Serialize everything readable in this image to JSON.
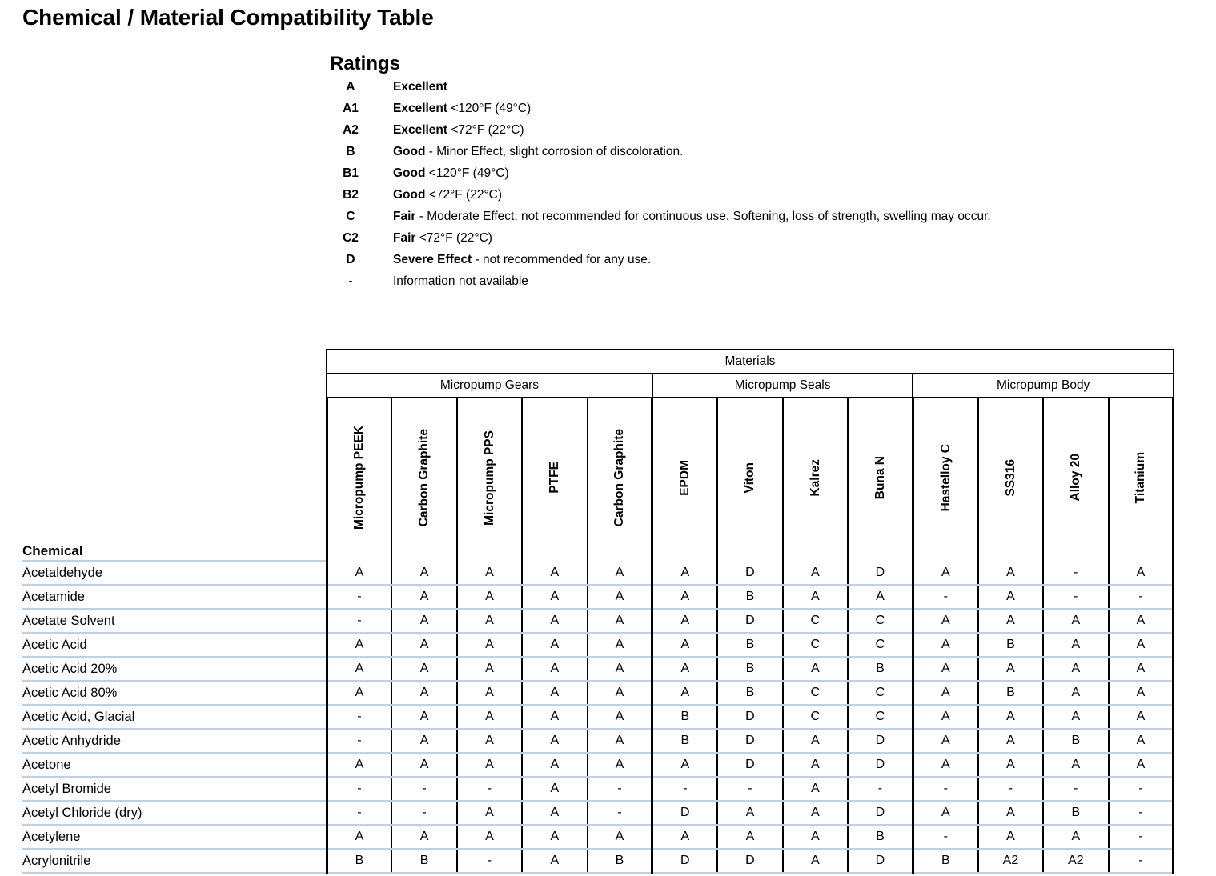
{
  "page_title": "Chemical / Material Compatibility Table",
  "ratings": {
    "heading": "Ratings",
    "items": [
      {
        "code": "A",
        "keyword": "Excellent",
        "rest": ""
      },
      {
        "code": "A1",
        "keyword": "Excellent",
        "rest": " <120°F (49°C)"
      },
      {
        "code": "A2",
        "keyword": "Excellent",
        "rest": " <72°F (22°C)"
      },
      {
        "code": "B",
        "keyword": "Good",
        "rest": " - Minor Effect, slight corrosion of discoloration."
      },
      {
        "code": "B1",
        "keyword": "Good",
        "rest": " <120°F (49°C)"
      },
      {
        "code": "B2",
        "keyword": "Good",
        "rest": " <72°F (22°C)"
      },
      {
        "code": "C",
        "keyword": "Fair",
        "rest": " - Moderate Effect, not recommended for continuous use.  Softening, loss of strength, swelling may occur."
      },
      {
        "code": "C2",
        "keyword": "Fair",
        "rest": " <72°F (22°C)"
      },
      {
        "code": "D",
        "keyword": "Severe Effect",
        "rest": " - not recommended for any use."
      },
      {
        "code": "-",
        "keyword": "",
        "rest": "Information not available"
      }
    ]
  },
  "chart_data": {
    "type": "table",
    "title": "Chemical / Material Compatibility Table",
    "top_group_label": "Materials",
    "column_groups": [
      {
        "label": "Micropump Gears",
        "span": 5
      },
      {
        "label": "Micropump Seals",
        "span": 4
      },
      {
        "label": "Micropump Body",
        "span": 4
      }
    ],
    "row_header_label": "Chemical",
    "columns": [
      "Micropump PEEK",
      "Carbon Graphite",
      "Micropump PPS",
      "PTFE",
      "Carbon Graphite",
      "EPDM",
      "Viton",
      "Kalrez",
      "Buna N",
      "Hastelloy C",
      "SS316",
      "Alloy 20",
      "Titanium"
    ],
    "rows": [
      {
        "chemical": "Acetaldehyde",
        "values": [
          "A",
          "A",
          "A",
          "A",
          "A",
          "A",
          "D",
          "A",
          "D",
          "A",
          "A",
          "-",
          "A"
        ]
      },
      {
        "chemical": "Acetamide",
        "values": [
          "-",
          "A",
          "A",
          "A",
          "A",
          "A",
          "B",
          "A",
          "A",
          "-",
          "A",
          "-",
          "-"
        ]
      },
      {
        "chemical": "Acetate Solvent",
        "values": [
          "-",
          "A",
          "A",
          "A",
          "A",
          "A",
          "D",
          "C",
          "C",
          "A",
          "A",
          "A",
          "A"
        ]
      },
      {
        "chemical": "Acetic Acid",
        "values": [
          "A",
          "A",
          "A",
          "A",
          "A",
          "A",
          "B",
          "C",
          "C",
          "A",
          "B",
          "A",
          "A"
        ]
      },
      {
        "chemical": "Acetic Acid 20%",
        "values": [
          "A",
          "A",
          "A",
          "A",
          "A",
          "A",
          "B",
          "A",
          "B",
          "A",
          "A",
          "A",
          "A"
        ]
      },
      {
        "chemical": "Acetic Acid 80%",
        "values": [
          "A",
          "A",
          "A",
          "A",
          "A",
          "A",
          "B",
          "C",
          "C",
          "A",
          "B",
          "A",
          "A"
        ]
      },
      {
        "chemical": "Acetic Acid, Glacial",
        "values": [
          "-",
          "A",
          "A",
          "A",
          "A",
          "B",
          "D",
          "C",
          "C",
          "A",
          "A",
          "A",
          "A"
        ]
      },
      {
        "chemical": "Acetic Anhydride",
        "values": [
          "-",
          "A",
          "A",
          "A",
          "A",
          "B",
          "D",
          "A",
          "D",
          "A",
          "A",
          "B",
          "A"
        ]
      },
      {
        "chemical": "Acetone",
        "values": [
          "A",
          "A",
          "A",
          "A",
          "A",
          "A",
          "D",
          "A",
          "D",
          "A",
          "A",
          "A",
          "A"
        ]
      },
      {
        "chemical": "Acetyl Bromide",
        "values": [
          "-",
          "-",
          "-",
          "A",
          "-",
          "-",
          "-",
          "A",
          "-",
          "-",
          "-",
          "-",
          "-"
        ]
      },
      {
        "chemical": "Acetyl Chloride (dry)",
        "values": [
          "-",
          "-",
          "A",
          "A",
          "-",
          "D",
          "A",
          "A",
          "D",
          "A",
          "A",
          "B",
          "-"
        ]
      },
      {
        "chemical": "Acetylene",
        "values": [
          "A",
          "A",
          "A",
          "A",
          "A",
          "A",
          "A",
          "A",
          "B",
          "-",
          "A",
          "A",
          "-"
        ]
      },
      {
        "chemical": "Acrylonitrile",
        "values": [
          "B",
          "B",
          "-",
          "A",
          "B",
          "D",
          "D",
          "A",
          "D",
          "B",
          "A2",
          "A2",
          "-"
        ]
      }
    ]
  },
  "colors": {
    "grid_dark": "#000000",
    "row_separator": "#bcd0e8",
    "text": "#000000",
    "background": "#ffffff"
  }
}
